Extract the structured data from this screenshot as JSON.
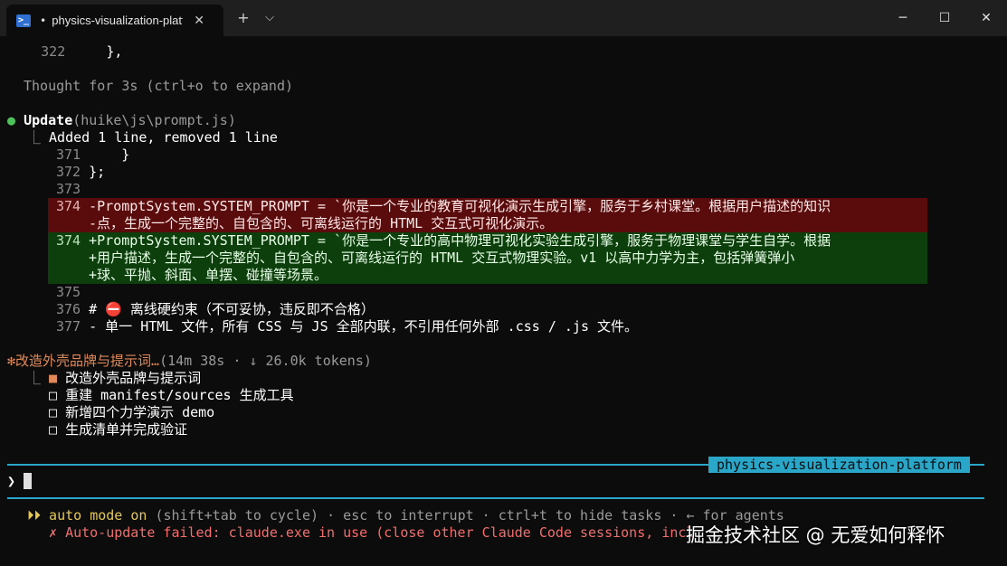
{
  "window": {
    "tab_title": "physics-visualization-platfor",
    "tab_dot": "•",
    "tab_icon": "powershell-icon",
    "new_tab": "+",
    "dropdown": "⌵",
    "minimize": "─",
    "maximize": "☐",
    "close": "✕",
    "tab_close": "✕"
  },
  "terminal": {
    "prev_line": {
      "num": "322",
      "text": "    },"
    },
    "thought": "Thought for 3s (ctrl+o to expand)",
    "update": {
      "bullet": "●",
      "label": "Update",
      "path": "(huike\\js\\prompt.js)",
      "summary_prefix": "⎿ ",
      "summary": "Added 1 line, removed 1 line"
    },
    "diff": [
      {
        "num": "371",
        "text": "    }"
      },
      {
        "num": "372",
        "text": "};"
      },
      {
        "num": "373",
        "text": ""
      }
    ],
    "removed": {
      "num": "374",
      "lines": [
        "-PromptSystem.SYSTEM_PROMPT = `你是一个专业的教育可视化演示生成引擎，服务于乡村课堂。根据用户描述的知识",
        "-点，生成一个完整的、自包含的、可离线运行的 HTML 交互式可视化演示。"
      ]
    },
    "added": {
      "num": "374",
      "lines": [
        "+PromptSystem.SYSTEM_PROMPT = `你是一个专业的高中物理可视化实验生成引擎，服务于物理课堂与学生自学。根据",
        "+用户描述，生成一个完整的、自包含的、可离线运行的 HTML 交互式物理实验。v1 以高中力学为主，包括弹簧弹小",
        "+球、平抛、斜面、单摆、碰撞等场景。"
      ]
    },
    "after": [
      {
        "num": "375",
        "text": ""
      },
      {
        "num": "376",
        "text": "# ⛔ 离线硬约束（不可妥协，违反即不合格）"
      },
      {
        "num": "377",
        "text": "- 单一 HTML 文件，所有 CSS 与 JS 全部内联，不引用任何外部 .css / .js 文件。"
      }
    ],
    "task": {
      "spinner": "✻",
      "title": "改造外壳品牌与提示词…",
      "stats": "(14m 38s · ↓ 26.0k tokens)",
      "items": [
        {
          "box": "■",
          "label": "改造外壳品牌与提示词"
        },
        {
          "box": "□",
          "label": "重建 manifest/sources 生成工具"
        },
        {
          "box": "□",
          "label": "新增四个力学演示 demo"
        },
        {
          "box": "□",
          "label": "生成清单并完成验证"
        }
      ]
    },
    "project_label": "physics-visualization-platform",
    "prompt_char": "❯",
    "footer": {
      "mode_arrows": "⏵⏵",
      "mode": "auto mode on",
      "hint": " (shift+tab to cycle) · esc to interrupt · ctrl+t to hide tasks · ← for agents",
      "error_icon": "✗",
      "error": "Auto-update failed: claude.exe in use (close other Claude Code sessions, incl"
    },
    "watermark": "掘金技术社区 @ 无爱如何释怀"
  },
  "colors": {
    "background": "#0c0c0c",
    "accent": "#2aa6c9",
    "removed_bg": "#5a0c0c",
    "added_bg": "#0c3f0c",
    "status_green": "#4ec25a",
    "task_orange": "#e08a5a",
    "error_red": "#f26d6d"
  }
}
